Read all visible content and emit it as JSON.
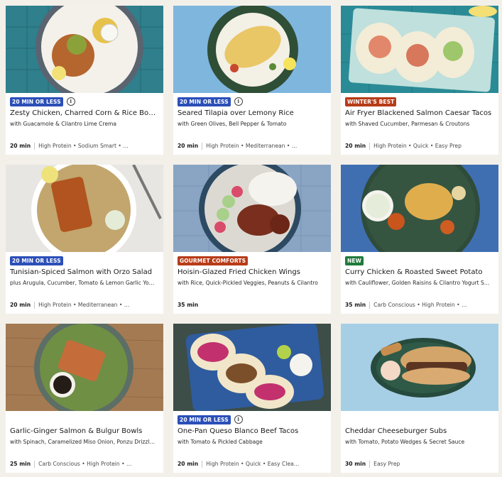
{
  "recipes": [
    {
      "tag": "20 MIN OR LESS",
      "tag_color": "blue",
      "info_icon": true,
      "title": "Zesty Chicken, Charred Corn & Rice Bo…",
      "subtitle": "with Guacamole & Cilantro Lime Crema",
      "time": "20 min",
      "tags": "High Protein • Sodium Smart • …",
      "photo": "chicken-rice-bowl"
    },
    {
      "tag": "20 MIN OR LESS",
      "tag_color": "blue",
      "info_icon": true,
      "title": "Seared Tilapia over Lemony Rice",
      "subtitle": "with Green Olives, Bell Pepper & Tomato",
      "time": "20 min",
      "tags": "High Protein • Mediterranean • …",
      "photo": "tilapia-rice"
    },
    {
      "tag": "WINTER'S BEST",
      "tag_color": "red",
      "info_icon": false,
      "title": "Air Fryer Blackened Salmon Caesar Tacos",
      "subtitle": "with Shaved Cucumber, Parmesan & Croutons",
      "time": "20 min",
      "tags": "High Protein • Quick • Easy Prep",
      "photo": "salmon-tacos"
    },
    {
      "tag": "20 MIN OR LESS",
      "tag_color": "blue",
      "info_icon": false,
      "title": "Tunisian-Spiced Salmon with Orzo Salad",
      "subtitle": "plus Arugula, Cucumber, Tomato & Lemon Garlic Yo…",
      "time": "20 min",
      "tags": "High Protein • Mediterranean • …",
      "photo": "salmon-orzo"
    },
    {
      "tag": "GOURMET COMFORTS",
      "tag_color": "red",
      "info_icon": false,
      "title": "Hoisin-Glazed Fried Chicken Wings",
      "subtitle": "with Rice, Quick-Pickled Veggies, Peanuts & Cilantro",
      "time": "35 min",
      "tags": "",
      "photo": "chicken-wings"
    },
    {
      "tag": "NEW",
      "tag_color": "green",
      "info_icon": false,
      "title": "Curry Chicken & Roasted Sweet Potato",
      "subtitle": "with Cauliflower, Golden Raisins & Cilantro Yogurt S…",
      "time": "35 min",
      "tags": "Carb Conscious • High Protein • …",
      "photo": "curry-chicken"
    },
    {
      "tag": "",
      "tag_color": "",
      "info_icon": false,
      "title": "Garlic-Ginger Salmon & Bulgur Bowls",
      "subtitle": "with Spinach, Caramelized Miso Onion, Ponzu Drizzl…",
      "time": "25 min",
      "tags": "Carb Conscious • High Protein • …",
      "photo": "salmon-bulgur"
    },
    {
      "tag": "20 MIN OR LESS",
      "tag_color": "blue",
      "info_icon": true,
      "title": "One-Pan Queso Blanco Beef Tacos",
      "subtitle": "with Tomato & Pickled Cabbage",
      "time": "20 min",
      "tags": "High Protein • Quick • Easy Clea…",
      "photo": "beef-tacos"
    },
    {
      "tag": "",
      "tag_color": "",
      "info_icon": false,
      "title": "Cheddar Cheeseburger Subs",
      "subtitle": "with Tomato, Potato Wedges & Secret Sauce",
      "time": "30 min",
      "tags": "Easy Prep",
      "photo": "cheeseburger-sub"
    }
  ]
}
